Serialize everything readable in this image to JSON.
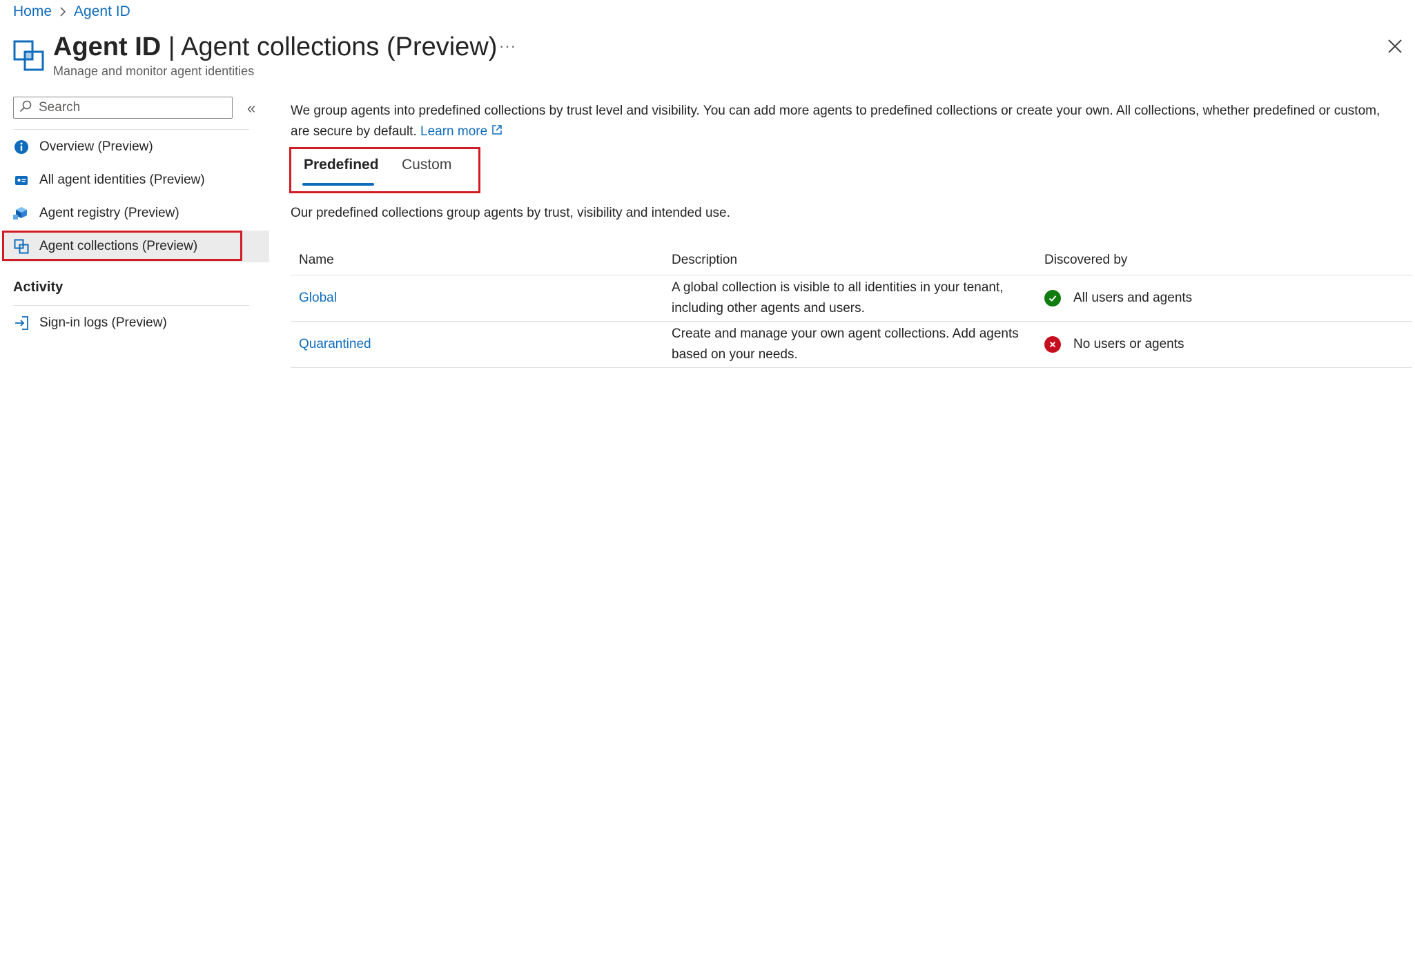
{
  "breadcrumb": {
    "home": "Home",
    "current": "Agent ID"
  },
  "header": {
    "title_bold": "Agent ID",
    "title_rest": " | Agent collections (Preview)",
    "subtitle": "Manage and monitor agent identities",
    "more": "···"
  },
  "sidebar": {
    "search_placeholder": "Search",
    "collapse": "«",
    "items": [
      {
        "label": "Overview (Preview)",
        "icon": "info-icon"
      },
      {
        "label": "All agent identities (Preview)",
        "icon": "id-card-icon"
      },
      {
        "label": "Agent registry (Preview)",
        "icon": "cubes-icon"
      },
      {
        "label": "Agent collections (Preview)",
        "icon": "collections-icon",
        "selected": true
      }
    ],
    "activity": {
      "heading": "Activity",
      "items": [
        {
          "label": "Sign-in logs (Preview)",
          "icon": "sign-in-icon"
        }
      ]
    }
  },
  "main": {
    "intro": "We group agents into predefined collections by trust level and visibility. You can add more agents to predefined collections or create your own. All collections, whether predefined or custom, are secure by default.",
    "learn_more": "Learn more",
    "tabs": [
      {
        "label": "Predefined",
        "active": true
      },
      {
        "label": "Custom",
        "active": false
      }
    ],
    "tab_description": "Our predefined collections group agents by trust, visibility and intended use.",
    "table": {
      "headers": [
        "Name",
        "Description",
        "Discovered by"
      ],
      "rows": [
        {
          "name": "Global",
          "description": "A global collection is visible to all identities in your tenant, including other agents and users.",
          "discovered_by": "All users and agents",
          "status": "success"
        },
        {
          "name": "Quarantined",
          "description": "Create and manage your own agent collections. Add agents based on your needs.",
          "discovered_by": "No users or agents",
          "status": "error"
        }
      ]
    }
  },
  "colors": {
    "accent": "#0f6cbd",
    "highlight": "#d11c24",
    "success": "#107c10",
    "error": "#c50f1f",
    "selected_bg": "#ebebeb"
  }
}
